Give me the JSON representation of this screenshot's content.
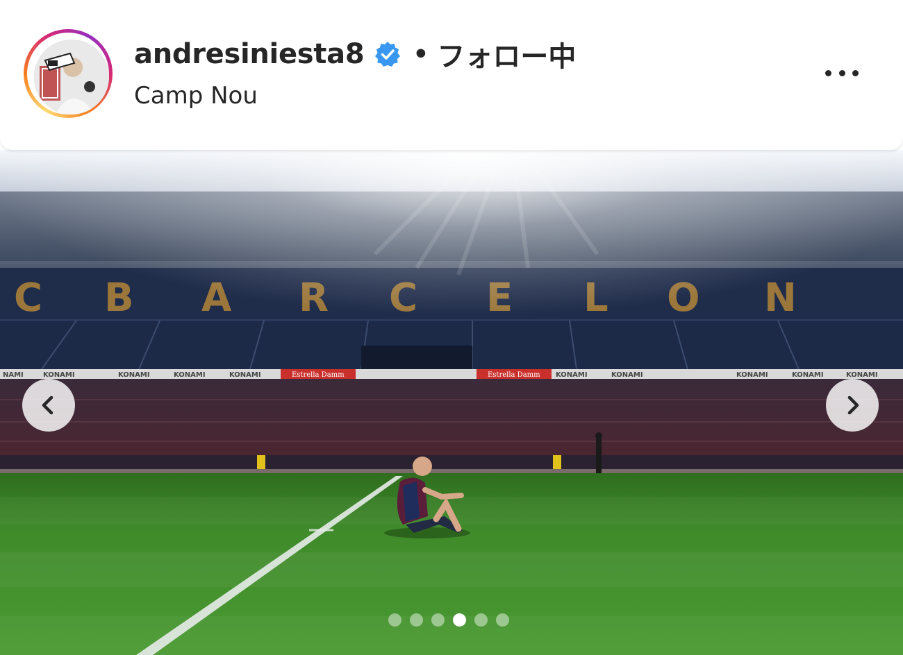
{
  "post_header": {
    "username": "andresiniesta8",
    "verified": true,
    "separator": "•",
    "follow_status": "フォロー中",
    "location": "Camp Nou",
    "ring_colors": [
      "#feda75",
      "#fa7e1e",
      "#d62976",
      "#962fbf"
    ],
    "verified_color": "#3897f0"
  },
  "carousel": {
    "slide_count": 6,
    "active_slide": 4,
    "prev_icon": "chevron-left-icon",
    "next_icon": "chevron-right-icon"
  },
  "photo": {
    "stand_lettering": "BARCELONA",
    "advertisers": [
      "KONAMI",
      "Estrella Damm"
    ]
  },
  "colors": {
    "pitch": "#3f8a2a",
    "stands": "#1f2c4a",
    "text": "#262626"
  }
}
